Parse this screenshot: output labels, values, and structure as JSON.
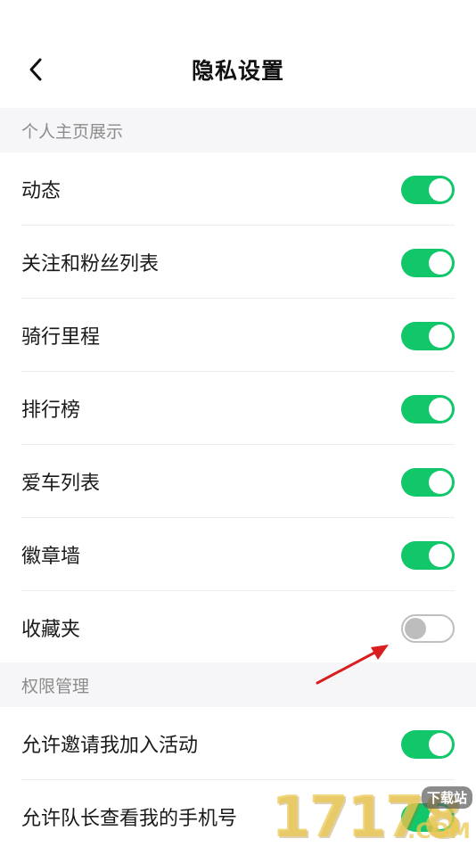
{
  "header": {
    "title": "隐私设置",
    "back_icon": "chevron-left-icon"
  },
  "sections": [
    {
      "title": "个人主页展示",
      "items": [
        {
          "label": "动态",
          "enabled": true
        },
        {
          "label": "关注和粉丝列表",
          "enabled": true
        },
        {
          "label": "骑行里程",
          "enabled": true
        },
        {
          "label": "排行榜",
          "enabled": true
        },
        {
          "label": "爱车列表",
          "enabled": true
        },
        {
          "label": "徽章墙",
          "enabled": true
        },
        {
          "label": "收藏夹",
          "enabled": false
        }
      ]
    },
    {
      "title": "权限管理",
      "items": [
        {
          "label": "允许邀请我加入活动",
          "enabled": true
        },
        {
          "label": "允许队长查看我的手机号",
          "enabled": true
        }
      ]
    }
  ],
  "watermark": {
    "digits": "17178",
    "suffix": ".COM",
    "site": "下载站"
  },
  "colors": {
    "toggle_on": "#12c76a",
    "toggle_off_border": "#bfbfbf",
    "section_bg": "#f6f6f8",
    "arrow": "#d81e1e"
  }
}
